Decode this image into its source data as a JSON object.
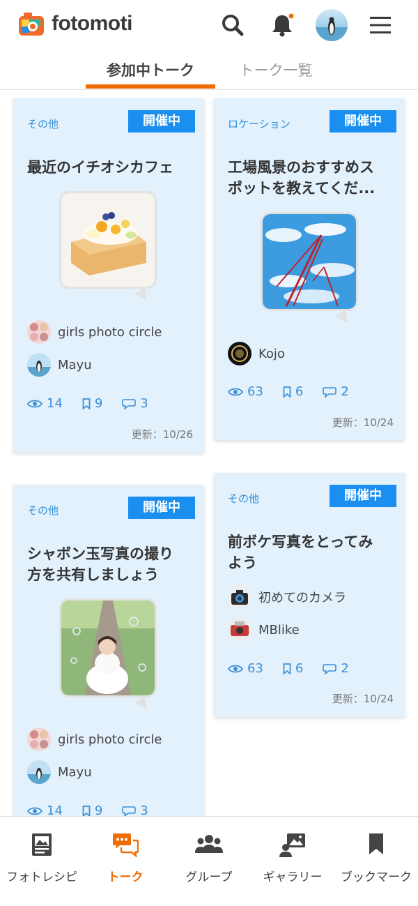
{
  "header": {
    "brand": "fotomoti",
    "icons": [
      "logo-mark",
      "search-icon",
      "bell-icon",
      "avatar",
      "hamburger-menu-icon"
    ]
  },
  "tabs": [
    {
      "label": "参加中トーク",
      "active": true
    },
    {
      "label": "トーク一覧",
      "active": false
    }
  ],
  "cards": [
    {
      "category": "その他",
      "badge": "開催中",
      "title_lines": [
        "最近のイチオシカフェ"
      ],
      "group": "girls photo circle",
      "user": "Mayu",
      "views": "14",
      "bookmarks": "9",
      "comments": "3",
      "updated": "更新：10/26"
    },
    {
      "category": "ロケーション",
      "badge": "開催中",
      "title_lines": [
        "工場風景のおすすめス",
        "ポットを教えてくだ..."
      ],
      "user": "Kojo",
      "views": "63",
      "bookmarks": "6",
      "comments": "2",
      "updated": "更新：10/24"
    },
    {
      "category": "その他",
      "badge": "開催中",
      "title_lines": [
        "シャボン玉写真の撮り",
        "方を共有しましょう"
      ],
      "group": "girls photo circle",
      "user": "Mayu",
      "views": "14",
      "bookmarks": "9",
      "comments": "3"
    },
    {
      "category": "その他",
      "badge": "開催中",
      "title_lines": [
        "前ボケ写真をとってみ",
        "よう"
      ],
      "group": "初めてのカメラ",
      "user": "MBlike",
      "views": "63",
      "bookmarks": "6",
      "comments": "2",
      "updated": "更新：10/24"
    }
  ],
  "bottom_nav": [
    {
      "label": "フォトレシピ",
      "icon": "photo-recipe-icon",
      "active": false
    },
    {
      "label": "トーク",
      "icon": "talk-icon",
      "active": true
    },
    {
      "label": "グループ",
      "icon": "group-icon",
      "active": false
    },
    {
      "label": "ギャラリー",
      "icon": "gallery-icon",
      "active": false
    },
    {
      "label": "ブックマーク",
      "icon": "bookmark-icon",
      "active": false
    }
  ],
  "colors": {
    "accent": "#ef6c00",
    "badge": "#1a8ff0",
    "card_bg": "#e3f1fd",
    "category_text": "#2f8fd8"
  }
}
